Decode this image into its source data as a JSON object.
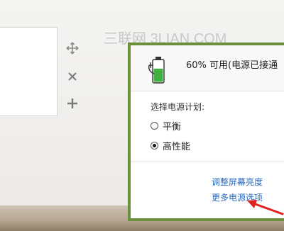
{
  "watermark": "三联网 3LIAN.COM",
  "tools": {
    "move_icon": "move-icon",
    "close_icon": "close-icon",
    "add_icon": "plus-icon"
  },
  "power_popup": {
    "battery_icon": "battery-plugged-icon",
    "status_text": "60% 可用(电源已接通",
    "battery_percent": 60,
    "plan_label": "选择电源计划:",
    "plans": [
      {
        "label": "平衡",
        "selected": false
      },
      {
        "label": "高性能",
        "selected": true
      }
    ],
    "links": {
      "brightness": "调整屏幕亮度",
      "more_options": "更多电源选项"
    },
    "border_color": "#6c8f3e",
    "link_color": "#2a6bbf",
    "arrow_color": "#e02020"
  }
}
